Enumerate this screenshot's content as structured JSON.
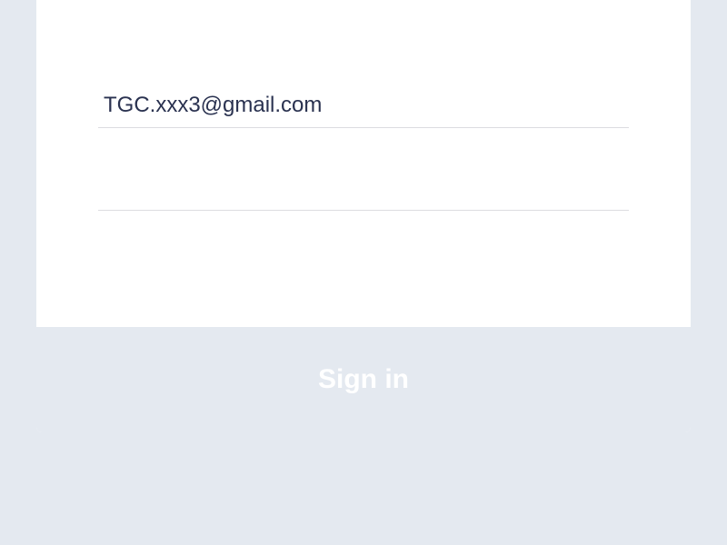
{
  "form": {
    "email_value": "TGC.xxx3@gmail.com",
    "password_value": "",
    "signin_label": "Sign in"
  }
}
